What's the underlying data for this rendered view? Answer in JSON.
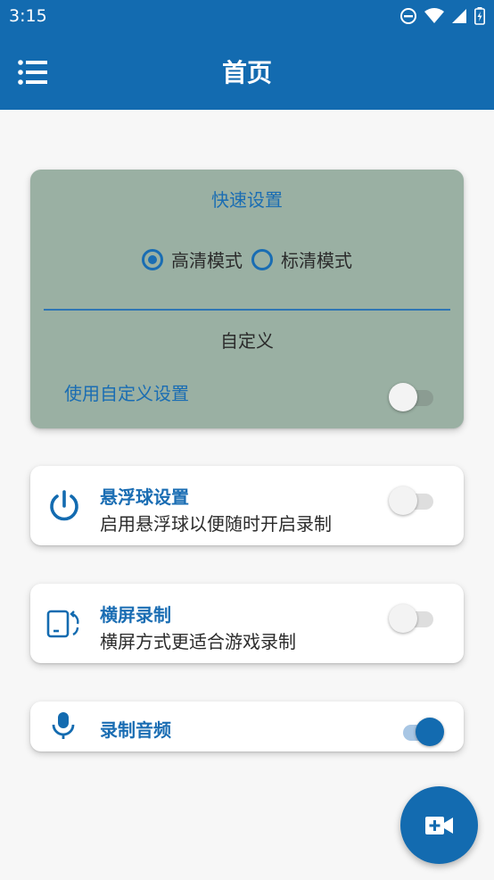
{
  "status_bar": {
    "time": "3:15"
  },
  "app_bar": {
    "title": "首页"
  },
  "quick_settings": {
    "title": "快速设置",
    "modes": [
      {
        "label": "高清模式",
        "selected": true
      },
      {
        "label": "标清模式",
        "selected": false
      }
    ],
    "custom_section_title": "自定义",
    "use_custom_label": "使用自定义设置",
    "use_custom_enabled": false
  },
  "floating_ball": {
    "title": "悬浮球设置",
    "subtitle": "启用悬浮球以便随时开启录制",
    "enabled": false,
    "icon": "power-icon"
  },
  "landscape": {
    "title": "横屏录制",
    "subtitle": "横屏方式更适合游戏录制",
    "enabled": false,
    "icon": "screen-rotation-icon"
  },
  "audio": {
    "title": "录制音频",
    "enabled": true,
    "icon": "microphone-icon"
  },
  "fab": {
    "icon": "video-camera-add-icon"
  },
  "colors": {
    "primary": "#136bb0",
    "quick_card_bg": "#9ab0a3"
  }
}
